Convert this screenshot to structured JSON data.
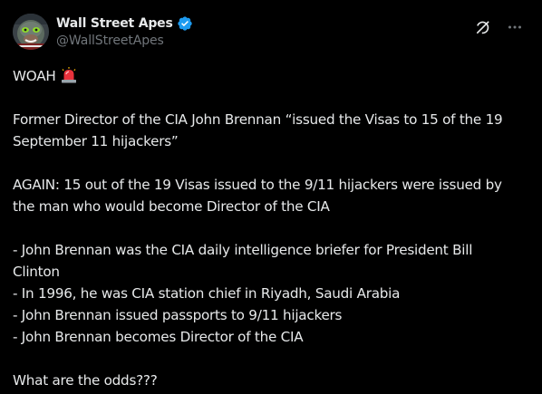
{
  "author": {
    "display_name": "Wall Street Apes",
    "handle": "@WallStreetApes",
    "verified": true,
    "verified_color": "#1d9bf0"
  },
  "icons": {
    "avatar": "ape-avatar",
    "verified": "verified-badge-icon",
    "grok": "grok-icon",
    "more": "more-options-icon",
    "emoji": "siren-emoji"
  },
  "post": {
    "line1": "WOAH",
    "line2": "Former Director of the CIA John Brennan “issued the Visas to 15 of the 19",
    "line3": "September 11 hijackers”",
    "line4": "AGAIN: 15 out of the 19 Visas issued to the 9/11 hijackers were issued by",
    "line5": "the man who would become Director of the CIA",
    "line6": "- John Brennan was the CIA daily intelligence briefer for President Bill",
    "line7": "Clinton",
    "line8": "- In 1996, he was CIA station chief in Riyadh, Saudi Arabia",
    "line9": "- John Brennan issued passports to 9/11 hijackers",
    "line10": "- John Brennan becomes Director of the CIA",
    "line11": "What are the odds???"
  },
  "colors": {
    "background": "#000000",
    "text": "#e7e9ea",
    "secondary_text": "#71767b"
  }
}
